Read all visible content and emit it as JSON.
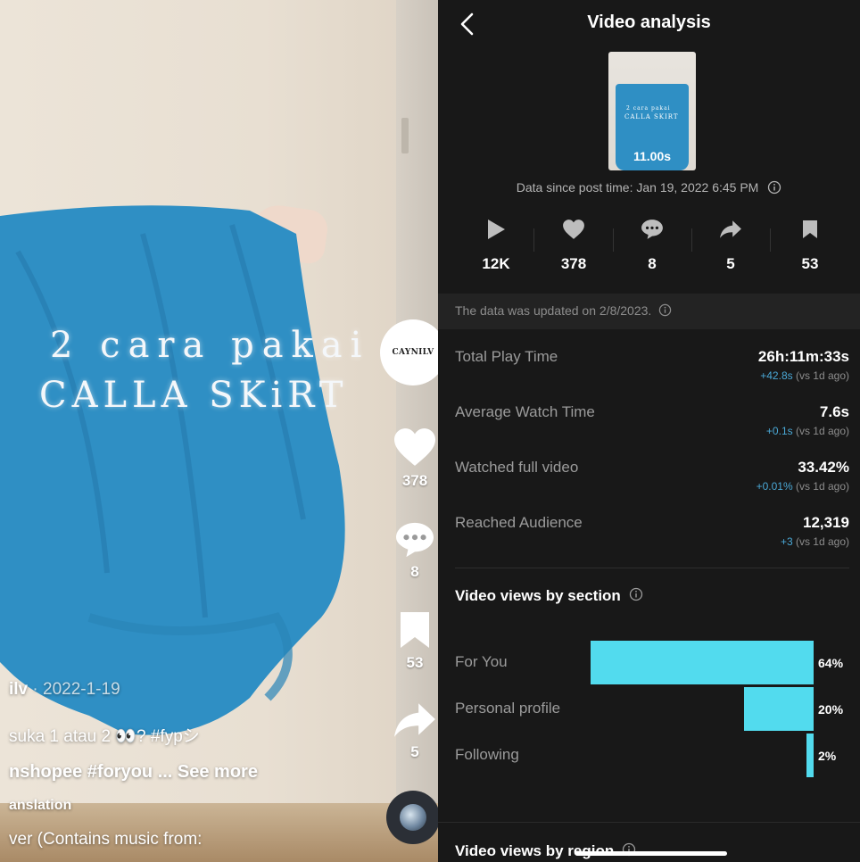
{
  "video_overlay": {
    "title_line1": "2 cara pakai",
    "title_line2": "CALLA SKiRT",
    "avatar_text": "CAYNILV",
    "likes": "378",
    "comments": "8",
    "saves": "53",
    "shares": "5",
    "username": "ilv",
    "date": " · 2022-1-19",
    "caption_line1": " suka 1 atau 2 👀? #fypシ",
    "caption_line2": "nshopee #foryou ... See more",
    "translation": "anslation",
    "music": "ver (Contains music from:"
  },
  "analysis": {
    "title": "Video analysis",
    "thumb_line1": "2 cara pakai",
    "thumb_line2": "CALLA SKIRT",
    "duration": "11.00s",
    "since": "Data since post time: Jan 19, 2022 6:45 PM",
    "stats": [
      {
        "icon": "play-icon",
        "value": "12K"
      },
      {
        "icon": "heart-icon",
        "value": "378"
      },
      {
        "icon": "comment-icon",
        "value": "8"
      },
      {
        "icon": "share-icon",
        "value": "5"
      },
      {
        "icon": "bookmark-icon",
        "value": "53"
      }
    ],
    "updated": "The data was updated on 2/8/2023.",
    "metrics": [
      {
        "label": "Total Play Time",
        "value": "26h:11m:33s",
        "delta": "+42.8s",
        "vs": " (vs 1d ago)"
      },
      {
        "label": "Average Watch Time",
        "value": "7.6s",
        "delta": "+0.1s",
        "vs": " (vs 1d ago)"
      },
      {
        "label": "Watched full video",
        "value": "33.42%",
        "delta": "+0.01%",
        "vs": " (vs 1d ago)"
      },
      {
        "label": "Reached Audience",
        "value": "12,319",
        "delta": "+3",
        "vs": " (vs 1d ago)"
      }
    ],
    "section_title": "Video views by section",
    "region_title": "Video views by region"
  },
  "chart_data": {
    "type": "bar",
    "orientation": "horizontal",
    "title": "Video views by section",
    "categories": [
      "For You",
      "Personal profile",
      "Following"
    ],
    "values": [
      64,
      20,
      2
    ],
    "value_labels": [
      "64%",
      "20%",
      "2%"
    ],
    "unit": "%",
    "color": "#52dbee",
    "grid": false
  },
  "colors": {
    "panel_bg": "#181818",
    "accent_bar": "#52dbee",
    "delta_positive": "#4aa8d6",
    "skirt": "#2f8fc4"
  }
}
